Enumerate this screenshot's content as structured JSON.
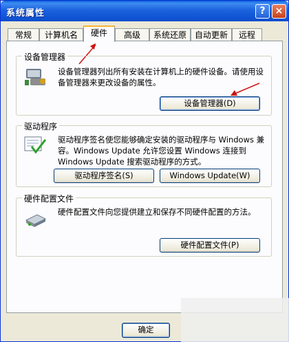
{
  "window": {
    "title": "系统属性"
  },
  "title_buttons": {
    "help": "?",
    "close": "×"
  },
  "tabs": [
    {
      "label": "常规"
    },
    {
      "label": "计算机名"
    },
    {
      "label": "硬件"
    },
    {
      "label": "高级"
    },
    {
      "label": "系统还原"
    },
    {
      "label": "自动更新"
    },
    {
      "label": "远程"
    }
  ],
  "device_manager": {
    "label": "设备管理器",
    "description": "设备管理器列出所有安装在计算机上的硬件设备。请使用设备管理器来更改设备的属性。",
    "button": "设备管理器(D)"
  },
  "drivers": {
    "label": "驱动程序",
    "description": "驱动程序签名使您能够确定安装的驱动程序与 Windows 兼容。Windows Update 允许您设置 Windows 连接到 Windows Update 搜索驱动程序的方式。",
    "signing_button": "驱动程序签名(S)",
    "update_button": "Windows Update(W)"
  },
  "hardware_profiles": {
    "label": "硬件配置文件",
    "description": "硬件配置文件向您提供建立和保存不同硬件配置的方法。",
    "button": "硬件配置文件(P)"
  },
  "footer": {
    "ok": "确定"
  },
  "icons": [
    "device-manager-icon",
    "driver-signing-icon",
    "hardware-profile-icon"
  ]
}
